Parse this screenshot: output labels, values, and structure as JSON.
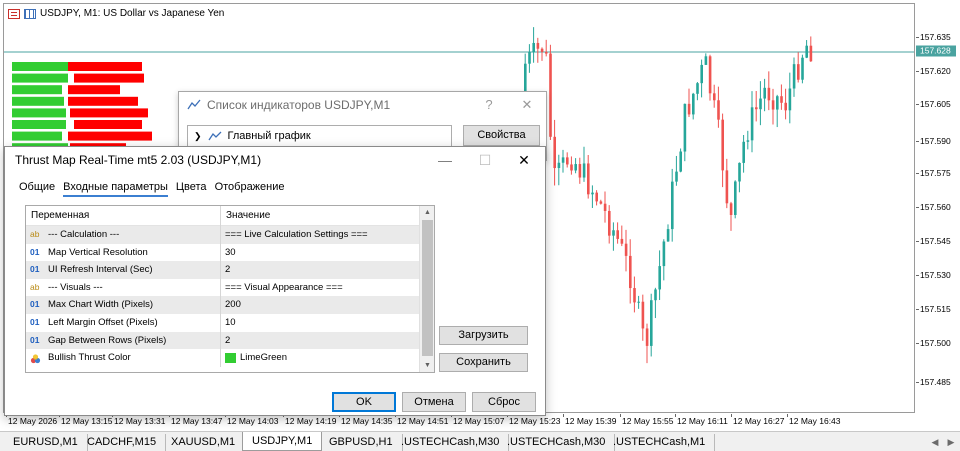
{
  "chart": {
    "title": "USDJPY, M1:  US Dollar vs Japanese Yen",
    "current_price": "157.628",
    "price_labels": [
      "157.635",
      "157.620",
      "157.605",
      "157.590",
      "157.575",
      "157.560",
      "157.545",
      "157.530",
      "157.515",
      "157.500",
      "157.485"
    ],
    "time_labels": [
      "12 May 2026",
      "12 May 13:15",
      "12 May 13:31",
      "12 May 13:47",
      "12 May 14:03",
      "12 May 14:19",
      "12 May 14:35",
      "12 May 14:51",
      "12 May 15:07",
      "12 May 15:23",
      "12 May 15:39",
      "12 May 15:55",
      "12 May 16:11",
      "12 May 16:27",
      "12 May 16:43"
    ],
    "colors": {
      "bull": "#26a69a",
      "bear": "#ef5350",
      "price_line": "#4aa3a0",
      "thrust_bull": "#32cd32",
      "thrust_bear": "#ff0000"
    }
  },
  "symbol_tabs": [
    "EURUSD,M1",
    "CADCHF,M15",
    "XAUUSD,M1",
    "USDJPY,M1",
    "GBPUSD,H1",
    ".USTECHCash,M30",
    ".USTECHCash,M30",
    ".USTECHCash,M1"
  ],
  "active_tab": "USDJPY,M1",
  "indicators_dialog": {
    "title": "Список индикаторов USDJPY,M1",
    "help": "?",
    "close": "✕",
    "tree_item": "Главный график",
    "properties_button": "Свойства"
  },
  "properties_dialog": {
    "title": "Thrust Map Real-Time mt5 2.03 (USDJPY,M1)",
    "tabs": [
      "Общие",
      "Входные параметры",
      "Цвета",
      "Отображение"
    ],
    "active_tab": "Входные параметры",
    "columns": {
      "variable": "Переменная",
      "value": "Значение"
    },
    "rows": [
      {
        "type": "ab",
        "type_label": "ab",
        "name": "--- Calculation ---",
        "value": "=== Live Calculation Settings ==="
      },
      {
        "type": "01",
        "type_label": "01",
        "name": "Map Vertical Resolution",
        "value": "30"
      },
      {
        "type": "01",
        "type_label": "01",
        "name": "UI Refresh Interval (Sec)",
        "value": "2"
      },
      {
        "type": "ab",
        "type_label": "ab",
        "name": "--- Visuals ---",
        "value": "=== Visual Appearance ==="
      },
      {
        "type": "01",
        "type_label": "01",
        "name": "Max Chart Width (Pixels)",
        "value": "200"
      },
      {
        "type": "01",
        "type_label": "01",
        "name": "Left Margin Offset (Pixels)",
        "value": "10"
      },
      {
        "type": "01",
        "type_label": "01",
        "name": "Gap Between Rows (Pixels)",
        "value": "2"
      },
      {
        "type": "color",
        "type_label": "",
        "name": "Bullish Thrust Color",
        "value": "LimeGreen"
      }
    ],
    "buttons": {
      "load": "Загрузить",
      "save": "Сохранить",
      "ok": "OK",
      "cancel": "Отмена",
      "reset": "Сброс"
    },
    "window_buttons": {
      "minimize": "—",
      "maximize": "☐",
      "close": "✕"
    }
  }
}
